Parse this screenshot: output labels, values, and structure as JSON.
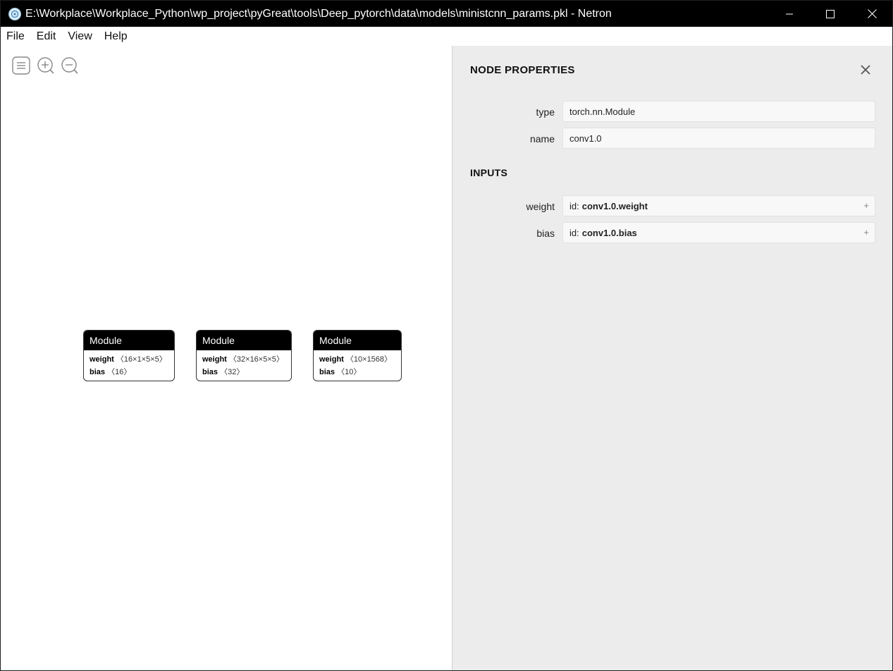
{
  "window": {
    "title": "E:\\Workplace\\Workplace_Python\\wp_project\\pyGreat\\tools\\Deep_pytorch\\data\\models\\ministcnn_params.pkl - Netron"
  },
  "menu": {
    "file": "File",
    "edit": "Edit",
    "view": "View",
    "help": "Help"
  },
  "nodes": [
    {
      "title": "Module",
      "rows": [
        {
          "name": "weight",
          "value": "〈16×1×5×5〉"
        },
        {
          "name": "bias",
          "value": "〈16〉"
        }
      ]
    },
    {
      "title": "Module",
      "rows": [
        {
          "name": "weight",
          "value": "〈32×16×5×5〉"
        },
        {
          "name": "bias",
          "value": "〈32〉"
        }
      ]
    },
    {
      "title": "Module",
      "rows": [
        {
          "name": "weight",
          "value": "〈10×1568〉"
        },
        {
          "name": "bias",
          "value": "〈10〉"
        }
      ]
    }
  ],
  "panel": {
    "title": "NODE PROPERTIES",
    "properties": [
      {
        "label": "type",
        "value": "torch.nn.Module"
      },
      {
        "label": "name",
        "value": "conv1.0"
      }
    ],
    "inputs_title": "INPUTS",
    "inputs": [
      {
        "label": "weight",
        "prefix": "id:",
        "value": "conv1.0.weight",
        "expand": "+"
      },
      {
        "label": "bias",
        "prefix": "id:",
        "value": "conv1.0.bias",
        "expand": "+"
      }
    ]
  },
  "colors": {
    "titlebar": "#000000",
    "node_header": "#000000",
    "panel_bg": "#ececec"
  },
  "icons": {
    "app": "netron-icon",
    "menu": "menu-icon",
    "zoom_in": "zoom-in-icon",
    "zoom_out": "zoom-out-icon",
    "close": "close-icon"
  }
}
